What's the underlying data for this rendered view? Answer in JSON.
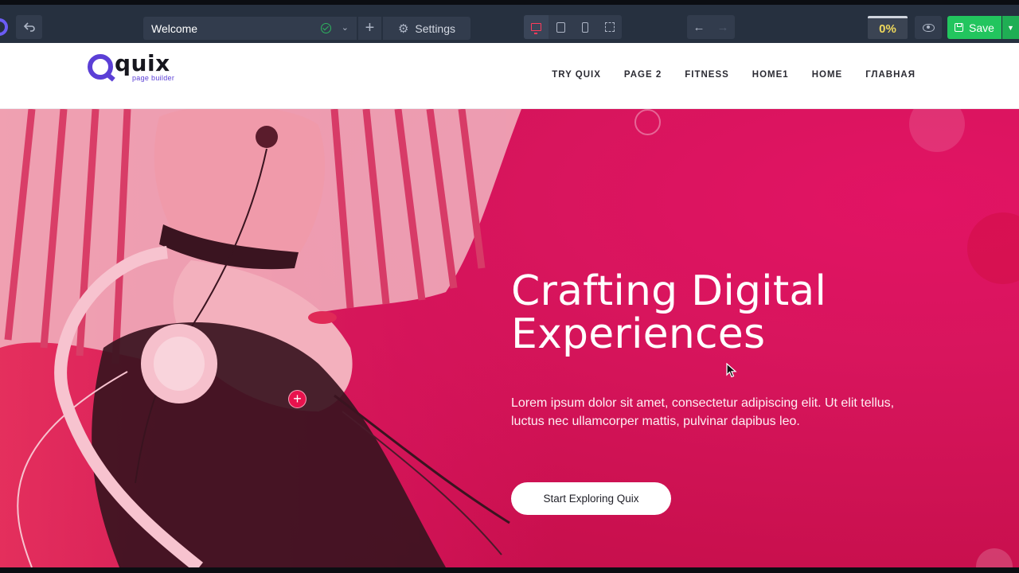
{
  "toolbar": {
    "page_name": "Welcome",
    "settings_label": "Settings",
    "progress": "0%",
    "save_label": "Save",
    "active_device": "desktop",
    "icons": [
      "quix-logo-icon",
      "undo-icon",
      "check-circle-icon",
      "chevron-down-icon",
      "plus-icon",
      "gear-icon",
      "desktop-icon",
      "tablet-icon",
      "mobile-icon",
      "fullscreen-icon",
      "arrow-left-icon",
      "arrow-right-icon",
      "eye-icon",
      "save-icon"
    ],
    "colors": {
      "bar": "#26303f",
      "button": "#323c4d",
      "save": "#22c55e",
      "progress_text": "#f0d95c",
      "active_device": "#ff3b5b"
    }
  },
  "site": {
    "brand": {
      "word": "quix",
      "tagline": "page builder",
      "color": "#5b3fd6"
    },
    "nav": [
      "TRY QUIX",
      "PAGE 2",
      "FITNESS",
      "HOME1",
      "HOME",
      "ГЛАВНАЯ"
    ]
  },
  "hero": {
    "title_line1": "Crafting Digital",
    "title_line2": "Experiences",
    "text": "Lorem ipsum dolor sit amet, consectetur adipiscing elit. Ut elit tellus, luctus nec ullamcorper mattis, pulvinar dapibus leo.",
    "cta_label": "Start Exploring Quix",
    "background_color": "#d8155d"
  }
}
